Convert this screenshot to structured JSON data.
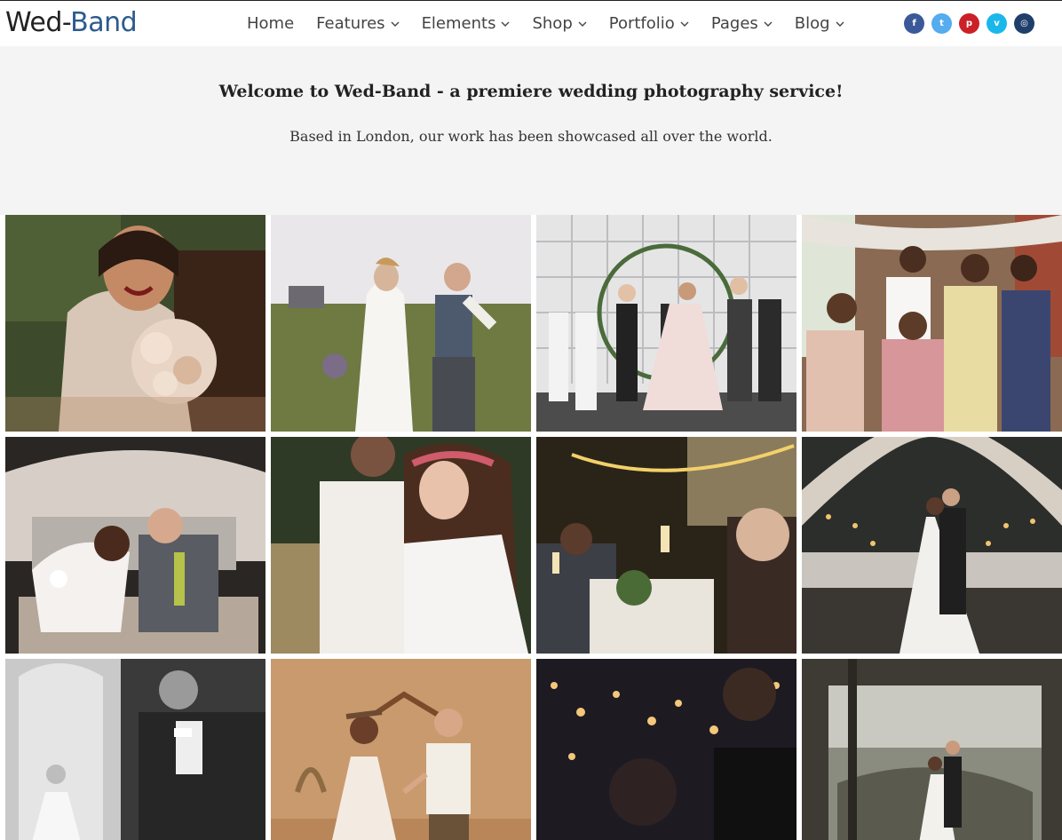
{
  "brand": {
    "part1": "Wed-",
    "part2": "Band",
    "color2": "#2c5a8f"
  },
  "nav": {
    "items": [
      {
        "label": "Home",
        "dropdown": false
      },
      {
        "label": "Features",
        "dropdown": true
      },
      {
        "label": "Elements",
        "dropdown": true
      },
      {
        "label": "Shop",
        "dropdown": true
      },
      {
        "label": "Portfolio",
        "dropdown": true
      },
      {
        "label": "Pages",
        "dropdown": true
      },
      {
        "label": "Blog",
        "dropdown": true
      }
    ]
  },
  "social": [
    {
      "name": "facebook-icon",
      "glyph": "f",
      "color": "#3b5998"
    },
    {
      "name": "twitter-icon",
      "glyph": "t",
      "color": "#55acee"
    },
    {
      "name": "pinterest-icon",
      "glyph": "p",
      "color": "#cb2027"
    },
    {
      "name": "vimeo-icon",
      "glyph": "v",
      "color": "#1ab7ea"
    },
    {
      "name": "instagram-icon",
      "glyph": "◎",
      "color": "#1f3f6b"
    }
  ],
  "hero": {
    "title": "Welcome to Wed-Band - a premiere wedding photography service!",
    "subtitle": "Based in London, our work has been showcased all over the world."
  },
  "gallery": [
    {
      "name": "bride-bouquet-photo"
    },
    {
      "name": "couple-field-photo"
    },
    {
      "name": "ceremony-arch-photo"
    },
    {
      "name": "bridesmaids-photo"
    },
    {
      "name": "couple-car-photo"
    },
    {
      "name": "flower-crown-couple-photo"
    },
    {
      "name": "reception-toast-photo"
    },
    {
      "name": "canopy-lights-couple-photo"
    },
    {
      "name": "groom-bw-photo"
    },
    {
      "name": "couple-dance-photo"
    },
    {
      "name": "evening-lights-photo"
    },
    {
      "name": "window-view-couple-photo"
    }
  ]
}
